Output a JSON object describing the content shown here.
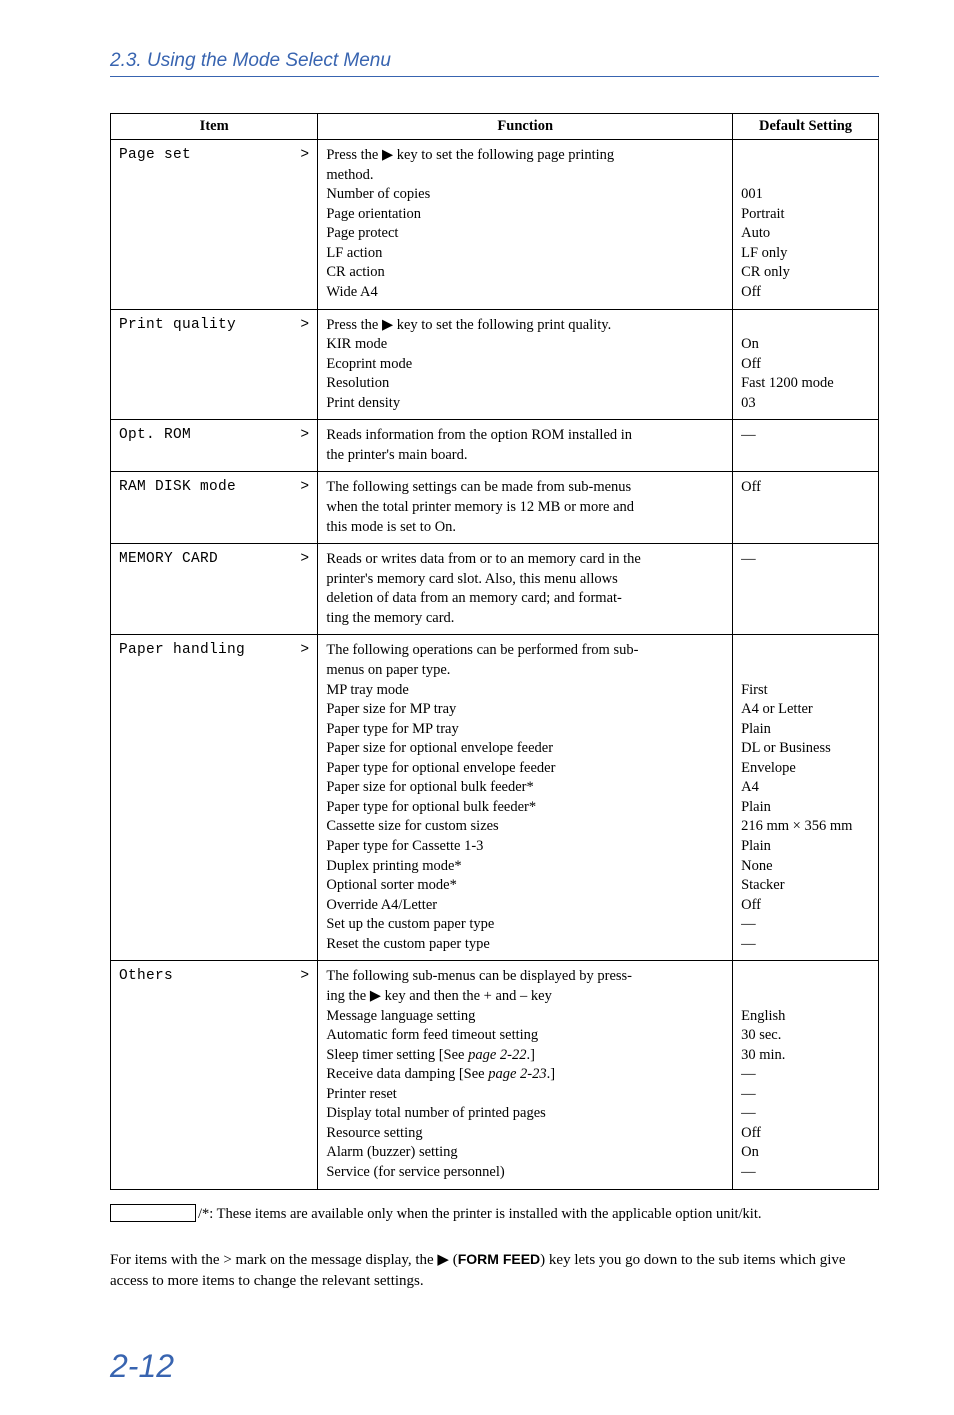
{
  "header": {
    "title": "2.3. Using the Mode Select Menu"
  },
  "table": {
    "headers": {
      "item": "Item",
      "function": "Function",
      "default_": "Default Setting"
    },
    "rows": [
      {
        "item_left": "Page set",
        "item_right": ">",
        "func_lines": [
          "Press the ▶ key to set the following page printing",
          "method.",
          "Number of copies",
          "Page orientation",
          "Page protect",
          "LF action",
          "CR action",
          "Wide A4"
        ],
        "def_lines": [
          "",
          "",
          "001",
          "Portrait",
          "Auto",
          "LF only",
          "CR only",
          "Off"
        ]
      },
      {
        "item_left": "Print quality",
        "item_right": ">",
        "func_lines": [
          "Press the ▶ key to set the following print quality.",
          "KIR mode",
          "Ecoprint mode",
          "Resolution",
          "Print density"
        ],
        "def_lines": [
          "",
          "On",
          "Off",
          "Fast 1200 mode",
          "03"
        ]
      },
      {
        "item_left": "Opt. ROM",
        "item_right": ">",
        "func_lines": [
          "Reads information from the option ROM installed in",
          "the printer's main board."
        ],
        "def_lines": [
          "—"
        ]
      },
      {
        "item_left": "RAM DISK mode",
        "item_right": ">",
        "func_lines": [
          "The following settings can be made from sub-menus",
          "when the total printer memory is 12 MB or more and",
          "this mode is set to On."
        ],
        "def_lines": [
          "Off"
        ]
      },
      {
        "item_left": "MEMORY CARD",
        "item_right": ">",
        "func_lines": [
          "Reads or writes data from or to an memory card in the",
          "printer's memory card slot. Also, this menu allows",
          "deletion of data from an memory card; and format-",
          "ting the memory card."
        ],
        "def_lines": [
          "—"
        ]
      },
      {
        "item_left": "Paper handling",
        "item_right": ">",
        "func_lines": [
          "The following operations can be performed from sub-",
          "menus on paper type.",
          "MP tray mode",
          "Paper size for MP tray",
          "Paper type for MP tray",
          "Paper size for optional envelope feeder",
          "Paper type for optional envelope feeder",
          "Paper size for optional bulk feeder*",
          "Paper type for optional bulk feeder*",
          "Cassette size for custom sizes",
          "Paper type for Cassette 1-3",
          "Duplex printing mode*",
          "Optional sorter mode*",
          "Override A4/Letter",
          "Set up the custom paper type",
          "Reset the custom paper type"
        ],
        "def_lines": [
          "",
          "",
          "First",
          "A4 or Letter",
          "Plain",
          "DL or Business",
          "Envelope",
          "A4",
          "Plain",
          "216 mm × 356 mm",
          "Plain",
          "None",
          "Stacker",
          "Off",
          "—",
          "—"
        ]
      },
      {
        "item_left": "Others",
        "item_right": ">",
        "func_lines": [
          "The following sub-menus can be displayed by press-",
          "ing the ▶ key and then the + and – key",
          "Message language setting",
          "Automatic form feed timeout setting",
          "Sleep timer setting [See page 2-22.]",
          "Receive data damping [See page 2-23.]",
          "Printer reset",
          "Display total number of printed pages",
          "Resource setting",
          "Alarm (buzzer) setting",
          "Service (for service personnel)"
        ],
        "def_lines": [
          "",
          "",
          "English",
          "30 sec.",
          "30 min.",
          "—",
          "—",
          "—",
          "Off",
          "On",
          "—"
        ]
      }
    ]
  },
  "footnote": "/*: These items are available only when the printer is installed with the applicable option unit/kit.",
  "body_para_1": "For items with the  >  mark on the message display, the ▶ (",
  "body_para_bold": "FORM FEED",
  "body_para_2": ") key lets you go down to the sub items which give access to more items to change the relevant settings.",
  "page_number": "2-12"
}
